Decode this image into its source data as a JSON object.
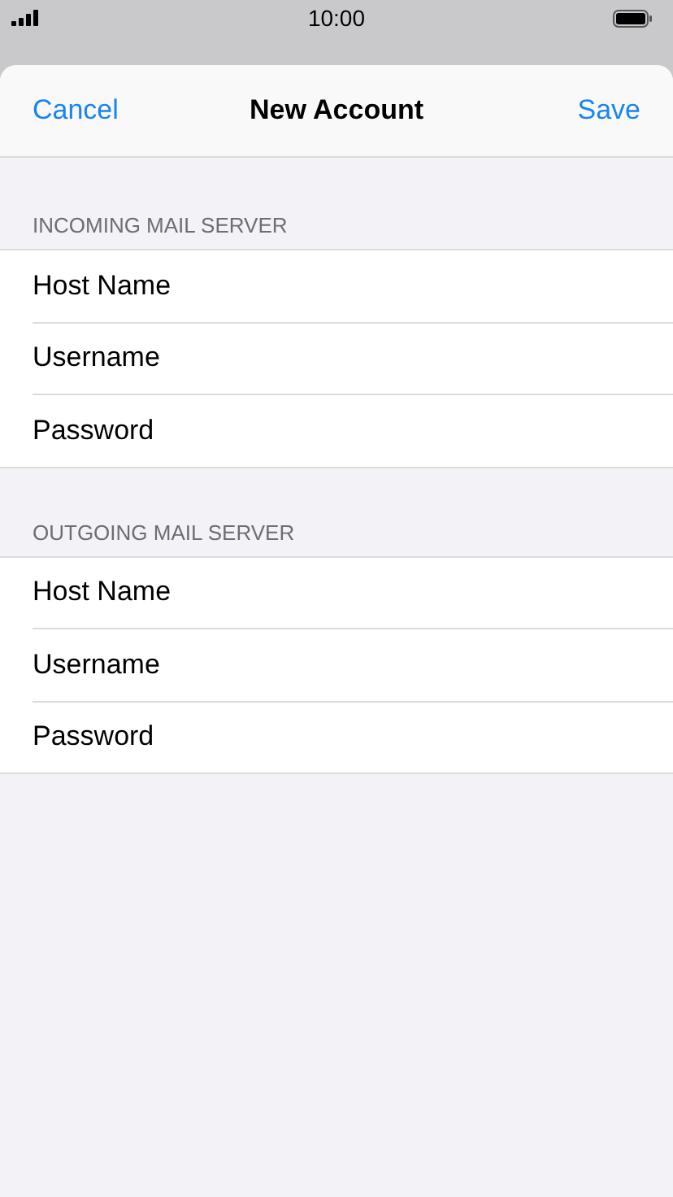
{
  "status_bar": {
    "time": "10:00"
  },
  "sheet": {
    "cancel": "Cancel",
    "title": "New Account",
    "save": "Save"
  },
  "sections": [
    {
      "header": "INCOMING MAIL SERVER",
      "fields": [
        {
          "placeholder": "Host Name"
        },
        {
          "placeholder": "Username"
        },
        {
          "placeholder": "Password"
        }
      ]
    },
    {
      "header": "OUTGOING MAIL SERVER",
      "fields": [
        {
          "placeholder": "Host Name"
        },
        {
          "placeholder": "Username"
        },
        {
          "placeholder": "Password"
        }
      ]
    }
  ]
}
